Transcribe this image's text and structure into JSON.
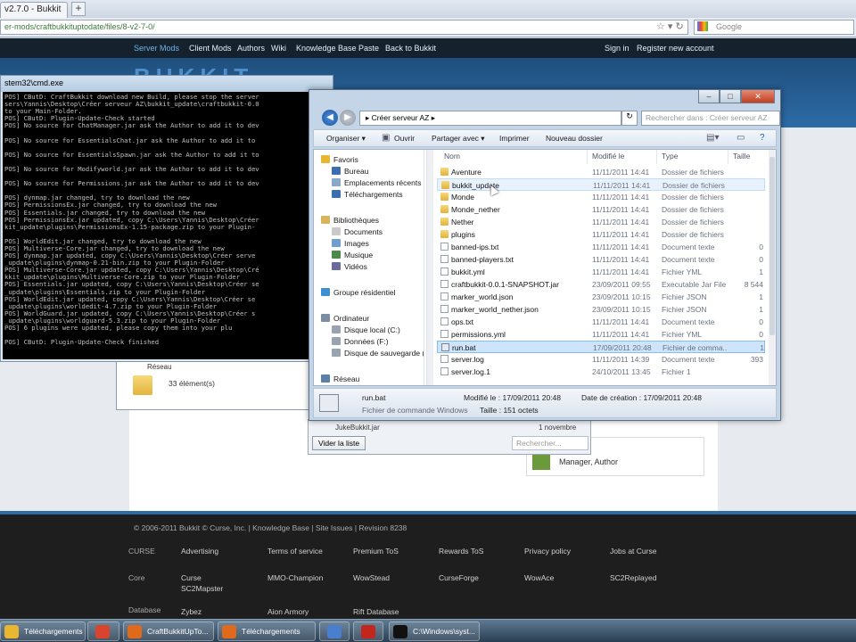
{
  "browser": {
    "tab_title": "v2.7.0 - Bukkit",
    "url": "er-mods/craftbukkituptodate/files/8-v2-7-0/",
    "search_placeholder": "Google"
  },
  "site": {
    "nav": [
      "Server Mods",
      "Client Mods",
      "Authors",
      "Wiki",
      "Knowledge Base",
      "Paste",
      "Back to Bukkit"
    ],
    "nav_right": [
      "Sign in",
      "Register new account"
    ],
    "logo_text": "BUKKIT",
    "footer": {
      "copyright": "© 2006-2011 Bukkit © Curse, Inc. | Knowledge Base | Site Issues | Revision 8238",
      "brand": "CURSE",
      "row1": [
        "Advertising",
        "Terms of service",
        "Premium ToS",
        "Rewards ToS",
        "Privacy policy",
        "Jobs at Curse"
      ],
      "row2_label": "Core",
      "row2": [
        "Curse",
        "MMO-Champion",
        "WowStead",
        "CurseForge",
        "WowAce",
        "SC2Replayed"
      ],
      "row2b": "SC2Mapster",
      "row3_label": "Database",
      "row3": [
        "Zybez",
        "Aion Armory",
        "Rift Database"
      ]
    },
    "author_box": "Manager, Author"
  },
  "cmd": {
    "title": "stem32\\cmd.exe",
    "lines": [
      "POS] CButD: CraftBukkit download new Build, please stop the server",
      "sers\\Yannis\\Desktop\\Créer serveur AZ\\bukkit_update\\craftbukkit-0.0",
      "to your Main-Folder.",
      "POS] CButD: Plugin-Update-Check started",
      "POS] No source for ChatManager.jar ask the Author to add it to dev",
      "",
      "POS] No source for EssentialsChat.jar ask the Author to add it to",
      "",
      "POS] No source for EssentialsSpawn.jar ask the Author to add it to",
      "",
      "POS] No source for Modifyworld.jar ask the Author to add it to dev",
      "",
      "POS] No source for Permissions.jar ask the Author to add it to dev",
      "",
      "POS] dynmap.jar changed, try to download the new",
      "POS] PermissionsEx.jar changed, try to download the new",
      "POS] Essentials.jar changed, try to download the new",
      "POS] PermissionsEx.jar updated, copy C:\\Users\\Yannis\\Desktop\\Créer",
      "kit_update\\plugins\\PermissionsEx-1.15-package.zip to your Plugin-",
      "",
      "POS] WorldEdit.jar changed, try to download the new",
      "POS] Multiverse-Core.jar changed, try to download the new",
      "POS] dynmap.jar updated, copy C:\\Users\\Yannis\\Desktop\\Créer serve",
      "_update\\plugins\\dynmap-0.21-bin.zip to your Plugin-Folder",
      "POS] Multiverse-Core.jar updated, copy C:\\Users\\Yannis\\Desktop\\Cré",
      "kkit_update\\plugins\\Multiverse-Core.zip to your Plugin-Folder",
      "POS] Essentials.jar updated, copy C:\\Users\\Yannis\\Desktop\\Créer se",
      "_update\\plugins\\Essentials.zip to your Plugin-Folder",
      "POS] WorldEdit.jar updated, copy C:\\Users\\Yannis\\Desktop\\Créer se",
      "_update\\plugins\\worldedit-4.7.zip to your Plugin-Folder",
      "POS] WorldGuard.jar updated, copy C:\\Users\\Yannis\\Desktop\\Créer s",
      "_update\\plugins\\worldguard-5.3.zip to your Plugin-Folder",
      "POS] 6 plugins were updated, please copy them into your plu",
      "",
      "POS] CButD: Plugin-Update-Check finished"
    ]
  },
  "bg_window": {
    "reseau": "Réseau",
    "count": "33 élément(s)"
  },
  "behind_panel": {
    "text": "JukeBukkit.jar",
    "date": "1 novembre",
    "clear_button": "Vider la liste",
    "search_placeholder": "Rechercher..."
  },
  "explorer": {
    "address": "Créer serveur AZ",
    "search_placeholder": "Rechercher dans : Créer serveur AZ",
    "toolbar": [
      "Organiser ▾",
      "Ouvrir",
      "Partager avec ▾",
      "Imprimer",
      "Nouveau dossier"
    ],
    "nav": [
      {
        "label": "Favoris",
        "icon": "star-icon",
        "color": "#e8b630",
        "indent": 0
      },
      {
        "label": "Bureau",
        "icon": "desktop-icon",
        "color": "#3d6fb0",
        "indent": 1
      },
      {
        "label": "Emplacements récents",
        "icon": "recent-places-icon",
        "color": "#8aa8c8",
        "indent": 1
      },
      {
        "label": "Téléchargements",
        "icon": "downloads-icon",
        "color": "#3d6fb0",
        "indent": 1
      },
      {
        "label": "Bibliothèques",
        "icon": "libraries-icon",
        "color": "#d9b45a",
        "indent": 0
      },
      {
        "label": "Documents",
        "icon": "documents-icon",
        "color": "#c9c9c9",
        "indent": 1
      },
      {
        "label": "Images",
        "icon": "images-icon",
        "color": "#6e9fcf",
        "indent": 1
      },
      {
        "label": "Musique",
        "icon": "music-icon",
        "color": "#4a8a4a",
        "indent": 1
      },
      {
        "label": "Vidéos",
        "icon": "videos-icon",
        "color": "#6b6b9b",
        "indent": 1
      },
      {
        "label": "Groupe résidentiel",
        "icon": "homegroup-icon",
        "color": "#3d8fd0",
        "indent": 0
      },
      {
        "label": "Ordinateur",
        "icon": "computer-icon",
        "color": "#7a8da3",
        "indent": 0
      },
      {
        "label": "Disque local (C:)",
        "icon": "drive-icon",
        "color": "#9aa4b0",
        "indent": 1
      },
      {
        "label": "Données (F:)",
        "icon": "drive-icon",
        "color": "#9aa4b0",
        "indent": 1
      },
      {
        "label": "Disque de sauvegarde (",
        "icon": "drive-icon",
        "color": "#9aa4b0",
        "indent": 1
      },
      {
        "label": "Réseau",
        "icon": "network-icon",
        "color": "#5a7fa8",
        "indent": 0
      }
    ],
    "columns": [
      "Nom",
      "Modifié le",
      "Type",
      "Taille"
    ],
    "files": [
      {
        "name": "Aventure",
        "date": "11/11/2011 14:41",
        "type": "Dossier de fichiers",
        "size": "",
        "kind": "folder"
      },
      {
        "name": "bukkit_update",
        "date": "11/11/2011 14:41",
        "type": "Dossier de fichiers",
        "size": "",
        "kind": "folder"
      },
      {
        "name": "Monde",
        "date": "11/11/2011 14:41",
        "type": "Dossier de fichiers",
        "size": "",
        "kind": "folder"
      },
      {
        "name": "Monde_nether",
        "date": "11/11/2011 14:41",
        "type": "Dossier de fichiers",
        "size": "",
        "kind": "folder"
      },
      {
        "name": "Nether",
        "date": "11/11/2011 14:41",
        "type": "Dossier de fichiers",
        "size": "",
        "kind": "folder"
      },
      {
        "name": "plugins",
        "date": "11/11/2011 14:41",
        "type": "Dossier de fichiers",
        "size": "",
        "kind": "folder"
      },
      {
        "name": "banned-ips.txt",
        "date": "11/11/2011 14:41",
        "type": "Document texte",
        "size": "0",
        "kind": "file"
      },
      {
        "name": "banned-players.txt",
        "date": "11/11/2011 14:41",
        "type": "Document texte",
        "size": "0",
        "kind": "file"
      },
      {
        "name": "bukkit.yml",
        "date": "11/11/2011 14:41",
        "type": "Fichier YML",
        "size": "1",
        "kind": "file"
      },
      {
        "name": "craftbukkit-0.0.1-SNAPSHOT.jar",
        "date": "23/09/2011 09:55",
        "type": "Executable Jar File",
        "size": "8 544",
        "kind": "file"
      },
      {
        "name": "marker_world.json",
        "date": "23/09/2011 10:15",
        "type": "Fichier JSON",
        "size": "1",
        "kind": "file"
      },
      {
        "name": "marker_world_nether.json",
        "date": "23/09/2011 10:15",
        "type": "Fichier JSON",
        "size": "1",
        "kind": "file"
      },
      {
        "name": "ops.txt",
        "date": "11/11/2011 14:41",
        "type": "Document texte",
        "size": "0",
        "kind": "file"
      },
      {
        "name": "permissions.yml",
        "date": "11/11/2011 14:41",
        "type": "Fichier YML",
        "size": "0",
        "kind": "file"
      },
      {
        "name": "run.bat",
        "date": "17/09/2011 20:48",
        "type": "Fichier de comma...",
        "size": "1",
        "kind": "bat"
      },
      {
        "name": "server.log",
        "date": "11/11/2011 14:39",
        "type": "Document texte",
        "size": "393",
        "kind": "file"
      },
      {
        "name": "server.log.1",
        "date": "24/10/2011 13:45",
        "type": "Fichier 1",
        "size": "",
        "kind": "file"
      }
    ],
    "selected_index": 14,
    "hover_index": 1,
    "details": {
      "name": "run.bat",
      "type": "Fichier de commande Windows",
      "modified": "Modifié le : 17/09/2011 20:48",
      "size": "Taille : 151 octets",
      "created": "Date de création : 17/09/2011 20:48"
    }
  },
  "taskbar": [
    {
      "label": "Téléchargements",
      "icon": "folder-icon",
      "color": "#e8b630"
    },
    {
      "label": "",
      "icon": "chrome-icon",
      "color": "#d9442f"
    },
    {
      "label": "CraftBukkitUpTo...",
      "icon": "firefox-icon",
      "color": "#e06a1c"
    },
    {
      "label": "Téléchargements",
      "icon": "firefox-icon",
      "color": "#e06a1c"
    },
    {
      "label": "",
      "icon": "itunes-icon",
      "color": "#4a7fd0"
    },
    {
      "label": "",
      "icon": "filezilla-icon",
      "color": "#c2261d"
    },
    {
      "label": "C:\\Windows\\syst...",
      "icon": "cmd-icon",
      "color": "#111111"
    }
  ]
}
